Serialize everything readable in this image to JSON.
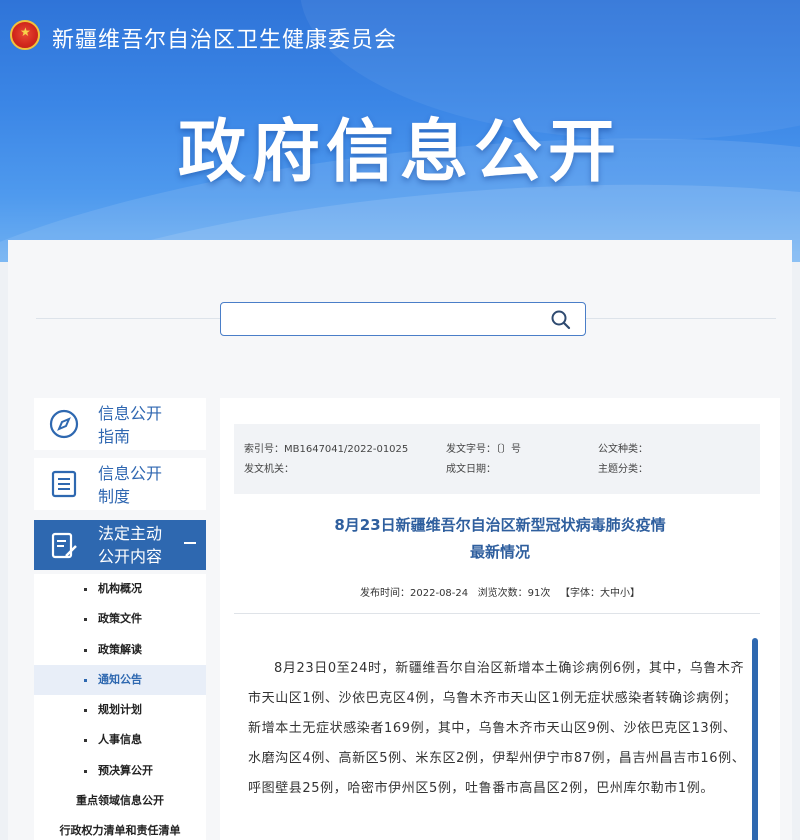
{
  "header": {
    "site_title": "新疆维吾尔自治区卫生健康委员会",
    "hero_title": "政府信息公开",
    "emblem_icon": "national-emblem-icon"
  },
  "search": {
    "placeholder": "",
    "icon": "search-icon"
  },
  "sidebar": {
    "items": [
      {
        "label_line1": "信息公开",
        "label_line2": "指南",
        "icon": "compass-icon"
      },
      {
        "label_line1": "信息公开",
        "label_line2": "制度",
        "icon": "document-list-icon"
      },
      {
        "label_line1": "法定主动",
        "label_line2": "公开内容",
        "icon": "edit-document-icon",
        "expanded": true
      }
    ],
    "submenu": [
      {
        "label": "机构概况"
      },
      {
        "label": "政策文件"
      },
      {
        "label": "政策解读"
      },
      {
        "label": "通知公告",
        "active": true
      },
      {
        "label": "规划计划"
      },
      {
        "label": "人事信息"
      },
      {
        "label": "预决算公开"
      }
    ],
    "groups": [
      {
        "label": "重点领域信息公开"
      },
      {
        "label": "行政权力清单和责任清单"
      }
    ]
  },
  "meta": {
    "index_no": "索引号：MB1647041/2022-01025",
    "doc_no": "发文字号：〔〕号",
    "doc_type": "公文种类：",
    "issuer": "发文机关：",
    "date_made": "成文日期：",
    "topic": "主题分类："
  },
  "article": {
    "title_line1": "8月23日新疆维吾尔自治区新型冠状病毒肺炎疫情",
    "title_line2": "最新情况",
    "publish_time": "发布时间：2022-08-24",
    "views": "浏览次数：91次",
    "font_size": "【字体：大中小】",
    "body": "8月23日0至24时，新疆维吾尔自治区新增本土确诊病例6例，其中，乌鲁木齐市天山区1例、沙依巴克区4例，乌鲁木齐市天山区1例无症状感染者转确诊病例；新增本土无症状感染者169例，其中，乌鲁木齐市天山区9例、沙依巴克区13例、水磨沟区4例、高新区5例、米东区2例，伊犁州伊宁市87例，昌吉州昌吉市16例、呼图壁县25例，哈密市伊州区5例，吐鲁番市高昌区2例，巴州库尔勒市1例。"
  },
  "colors": {
    "banner": "#3b86e6",
    "accent": "#2e68b0",
    "title_blue": "#2f5f9e"
  }
}
